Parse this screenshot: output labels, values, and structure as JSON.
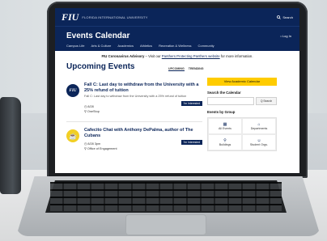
{
  "header": {
    "logo": "FIU",
    "university": "FLORIDA INTERNATIONAL UNIVERSITY",
    "search_label": "Search"
  },
  "hero": {
    "title": "Events Calendar",
    "login": "Log In",
    "nav": [
      "Campus Life",
      "Arts & Culture",
      "Academics",
      "Athletics",
      "Recreation & Wellness",
      "Community"
    ]
  },
  "advisory": {
    "lead": "FIU Coronavirus Advisory",
    "text": " – Visit our ",
    "link": "Panthers Protecting Panthers website",
    "tail": " for more information."
  },
  "main": {
    "heading": "Upcoming Events",
    "tabs": [
      "UPCOMING",
      "TRENDING"
    ],
    "events": [
      {
        "title": "Fall C: Last day to withdraw from the University with a 25% refund of tuition",
        "subtitle": "Fall C: Last day to withdraw from the University with a 25% refund of tuition",
        "date": "8/28",
        "location": "OneStop",
        "action": "I'm Interested"
      },
      {
        "title": "Cafecito Chat with Anthony DePalma, author of The Cubans",
        "date": "8/28 3pm",
        "location": "Office of Engagement",
        "action": "I'm Interested"
      }
    ]
  },
  "sidebar": {
    "view_calendar": "View Academic Calendar",
    "search_heading": "Search the Calendar",
    "search_button": "Q Search",
    "group_heading": "Events by Group",
    "groups": [
      "All Events",
      "Departments",
      "Buildings",
      "Student Orgs."
    ]
  },
  "colors": {
    "brand": "#0b2559",
    "accent": "#ffcc00"
  }
}
